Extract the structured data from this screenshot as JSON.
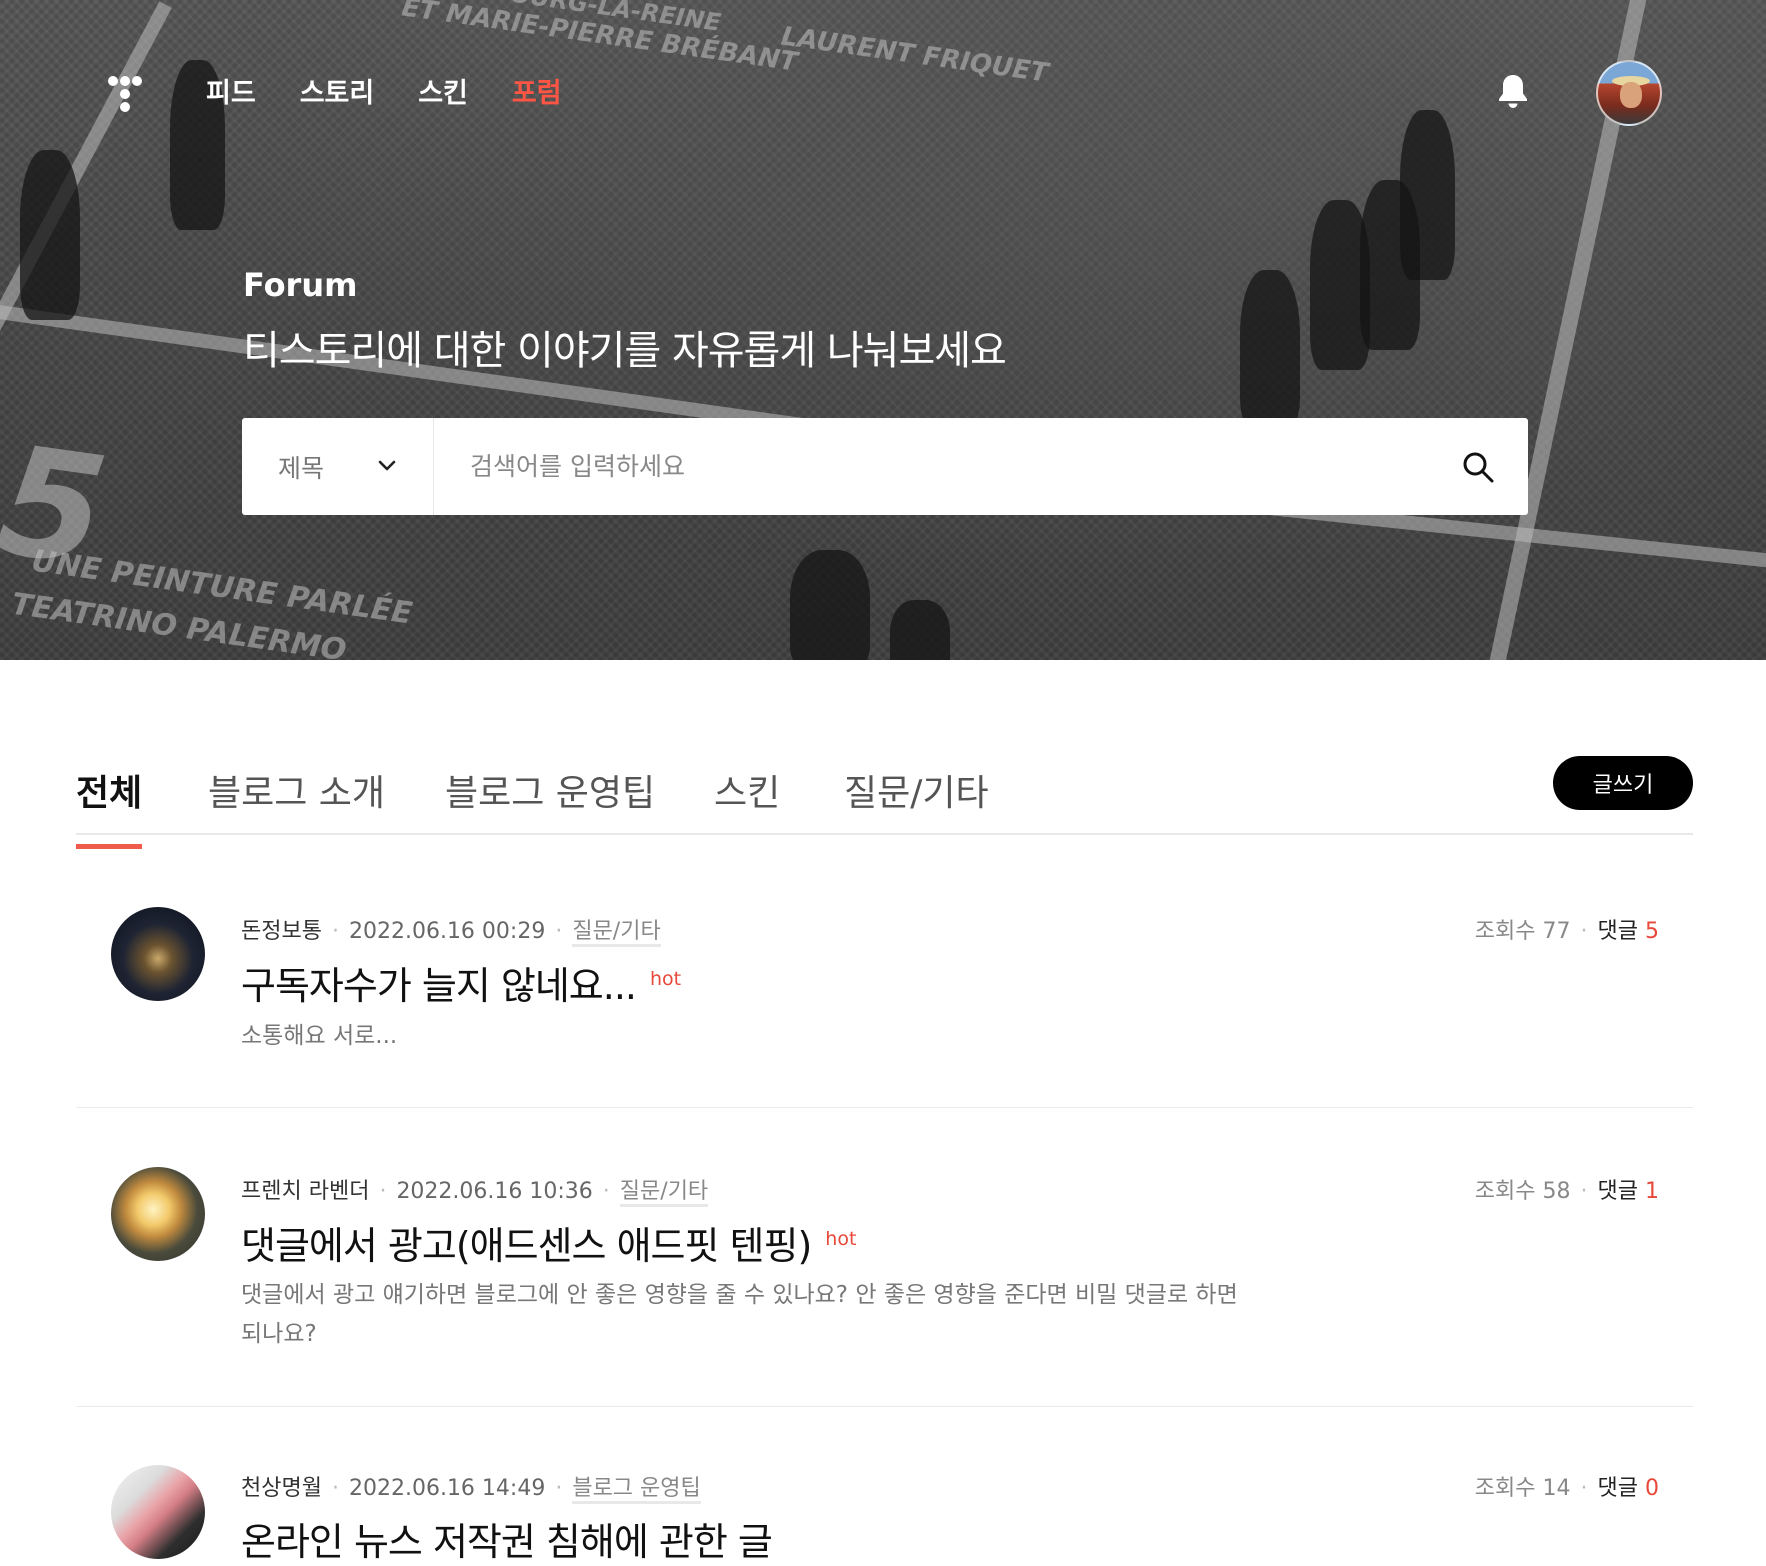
{
  "nav": {
    "items": [
      "피드",
      "스토리",
      "스킨",
      "포럼"
    ],
    "active_index": 3
  },
  "icons": {
    "logo": "tistory-logo-icon",
    "notification": "bell-icon",
    "search": "search-icon",
    "dropdown": "chevron-down-icon"
  },
  "hero": {
    "title": "Forum",
    "subtitle": "티스토리에 대한 이야기를 자유롭게 나눠보세요",
    "background_words": [
      "UNE PEINTURE PARLÉE",
      "TEATRINO PALERMO",
      "ET MARIE-PIERRE BRÉBANT",
      "LAURENT FRIQUET",
      "BEAUBOURG-LA-REINE"
    ]
  },
  "search": {
    "select_value": "제목",
    "placeholder": "검색어를 입력하세요"
  },
  "tabs": {
    "items": [
      "전체",
      "블로그 소개",
      "블로그 운영팁",
      "스킨",
      "질문/기타"
    ],
    "active_index": 0,
    "write_label": "글쓰기"
  },
  "colors": {
    "accent": "#ef5a4a",
    "active_nav": "#ff5544",
    "write_button_bg": "#000000"
  },
  "posts": [
    {
      "author": "돈정보통",
      "date": "2022.06.16 00:29",
      "category": "질문/기타",
      "title": "구독자수가 늘지 않네요...",
      "hot": "hot",
      "excerpt": "소통해요 서로...",
      "views_label": "조회수 77",
      "comments_label": "댓글",
      "comments": "5"
    },
    {
      "author": "프렌치 라벤더",
      "date": "2022.06.16 10:36",
      "category": "질문/기타",
      "title": "댓글에서 광고(애드센스 애드핏 텐핑)",
      "hot": "hot",
      "excerpt": "댓글에서 광고 얘기하면 블로그에 안 좋은 영향을 줄 수 있나요? 안 좋은 영향을 준다면 비밀 댓글로 하면 되나요?",
      "views_label": "조회수 58",
      "comments_label": "댓글",
      "comments": "1"
    },
    {
      "author": "천상명월",
      "date": "2022.06.16 14:49",
      "category": "블로그 운영팁",
      "title": "온라인 뉴스 저작권 침해에 관한 글",
      "views_label": "조회수 14",
      "comments_label": "댓글",
      "comments": "0"
    }
  ]
}
